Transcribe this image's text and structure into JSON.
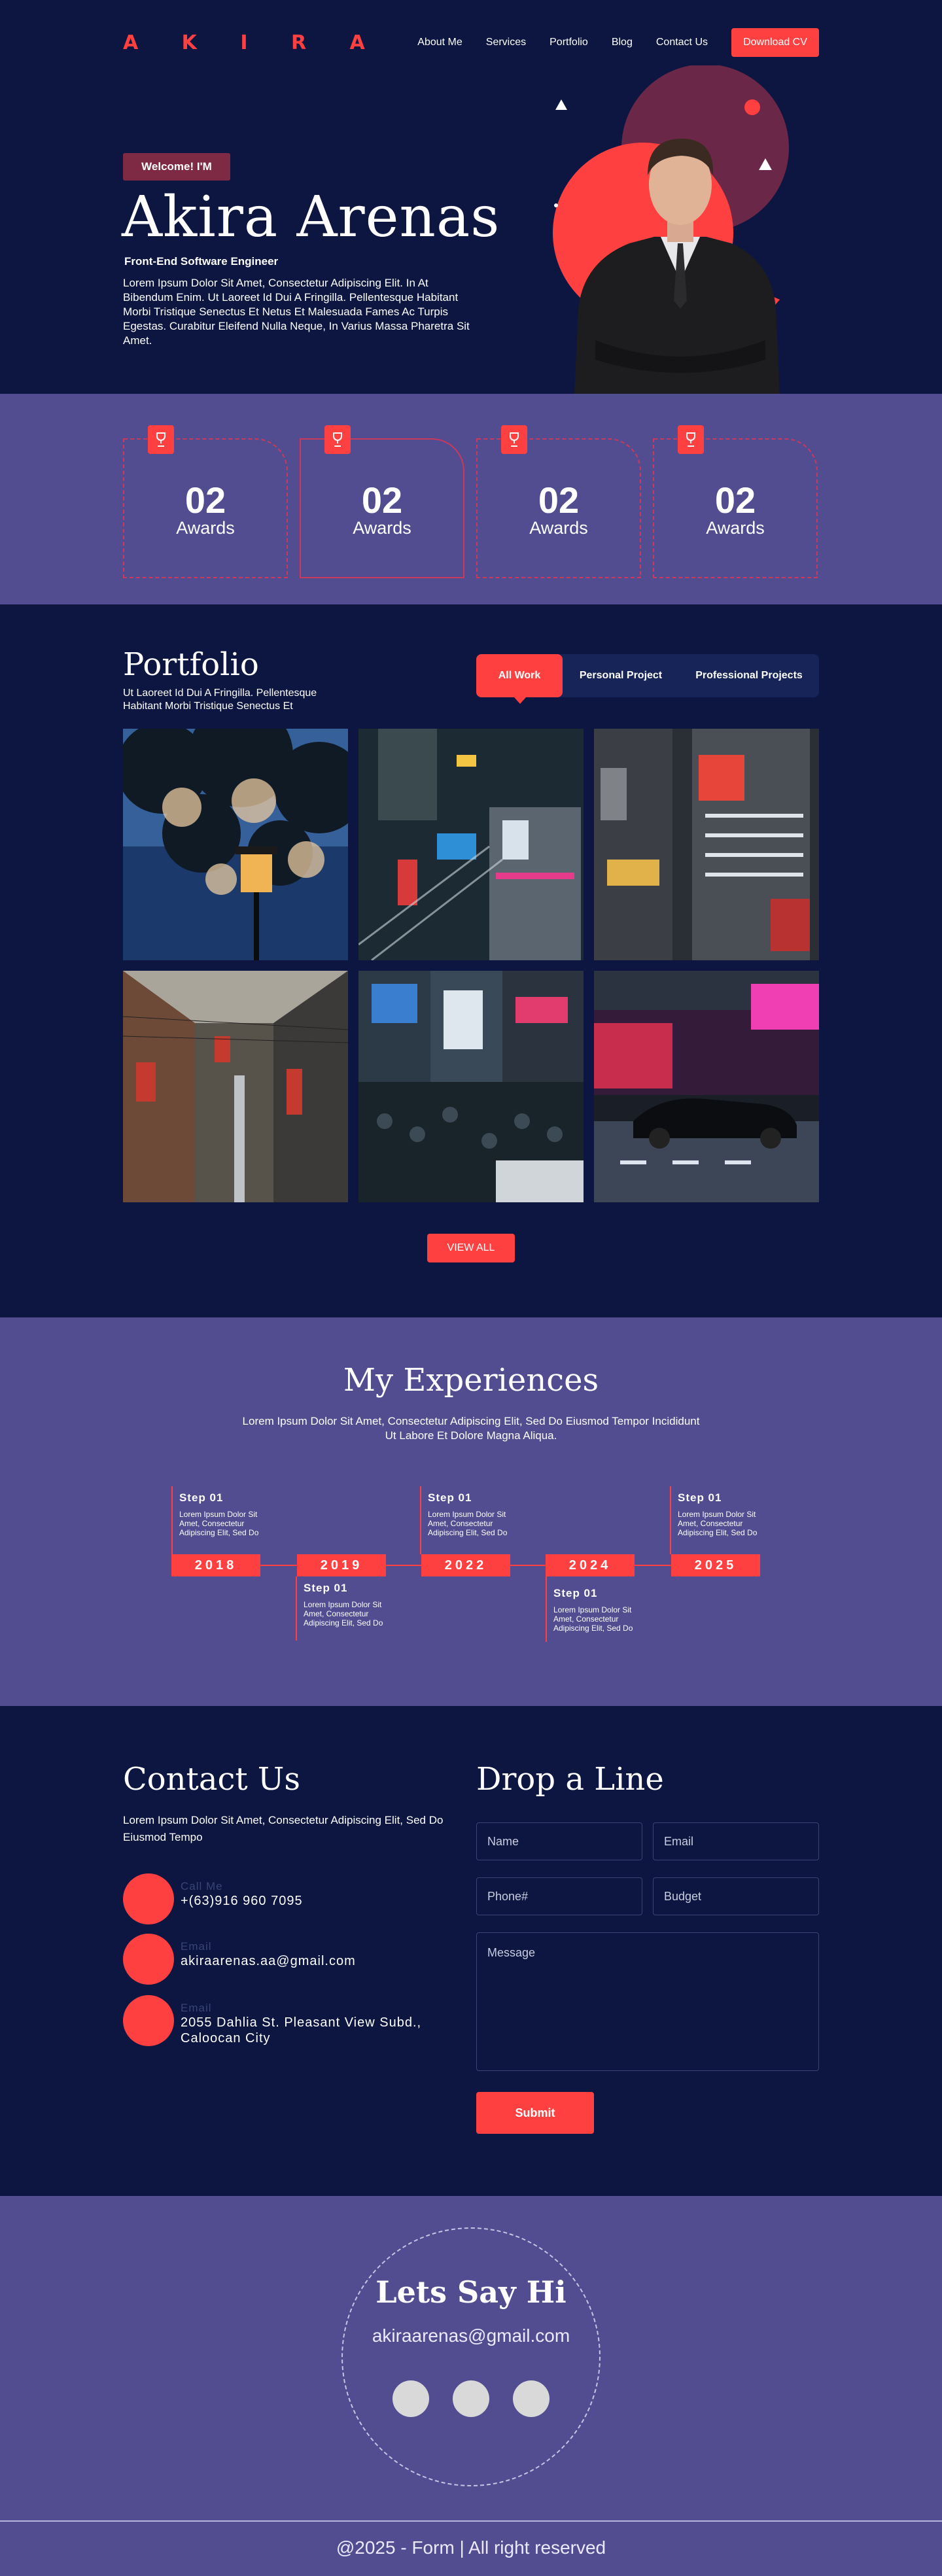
{
  "header": {
    "logo": "A K I R A",
    "nav": [
      "About Me",
      "Services",
      "Portfolio",
      "Blog",
      "Contact Us"
    ],
    "cta": "Download CV"
  },
  "hero": {
    "badge": "Welcome! I'M",
    "name": "Akira Arenas",
    "role": "Front-End Software Engineer",
    "description": "Lorem Ipsum Dolor Sit Amet, Consectetur Adipiscing Elit. In At Bibendum Enim. Ut Laoreet Id Dui A Fringilla. Pellentesque Habitant Morbi Tristique Senectus Et Netus Et Malesuada Fames Ac Turpis Egestas. Curabitur Eleifend Nulla Neque, In Varius Massa Pharetra Sit Amet."
  },
  "awards": [
    {
      "number": "02",
      "label": "Awards"
    },
    {
      "number": "02",
      "label": "Awards"
    },
    {
      "number": "02",
      "label": "Awards"
    },
    {
      "number": "02",
      "label": "Awards"
    }
  ],
  "portfolio": {
    "title": "Portfolio",
    "subtitle": "Ut Laoreet Id Dui A Fringilla. Pellentesque Habitant Morbi Tristique Senectus Et",
    "tabs": [
      "All Work",
      "Personal Project",
      "Professional Projects"
    ],
    "view_all": "VIEW ALL"
  },
  "experience": {
    "title": "My Experiences",
    "subtitle": "Lorem Ipsum Dolor Sit Amet, Consectetur Adipiscing Elit, Sed Do Eiusmod Tempor Incididunt Ut Labore Et Dolore Magna Aliqua.",
    "years": [
      "2018",
      "2019",
      "2022",
      "2024",
      "2025"
    ],
    "steps": [
      {
        "title": "Step 01",
        "desc": "Lorem Ipsum Dolor Sit Amet, Consectetur Adipiscing Elit, Sed Do"
      },
      {
        "title": "Step 01",
        "desc": "Lorem Ipsum Dolor Sit Amet, Consectetur Adipiscing Elit, Sed Do"
      },
      {
        "title": "Step 01",
        "desc": "Lorem Ipsum Dolor Sit Amet, Consectetur Adipiscing Elit, Sed Do"
      },
      {
        "title": "Step 01",
        "desc": "Lorem Ipsum Dolor Sit Amet, Consectetur Adipiscing Elit, Sed Do"
      },
      {
        "title": "Step 01",
        "desc": "Lorem Ipsum Dolor Sit Amet, Consectetur Adipiscing Elit, Sed Do"
      }
    ]
  },
  "contact": {
    "title": "Contact Us",
    "subtitle": "Lorem Ipsum Dolor Sit Amet, Consectetur Adipiscing Elit, Sed Do Eiusmod Tempo",
    "items": [
      {
        "label": "Call Me",
        "value": "+(63)916 960 7095"
      },
      {
        "label": "Email",
        "value": "akiraarenas.aa@gmail.com"
      },
      {
        "label": "Email",
        "value": "2055 Dahlia St. Pleasant View Subd., Caloocan City"
      }
    ]
  },
  "form": {
    "title": "Drop a Line",
    "name_placeholder": "Name",
    "email_placeholder": "Email",
    "phone_placeholder": "Phone#",
    "budget_placeholder": "Budget",
    "message_placeholder": "Message",
    "submit": "Submit"
  },
  "footer": {
    "title": "Lets Say Hi",
    "email": "akiraarenas@gmail.com",
    "copyright": "@2025 - Form | All right reserved"
  },
  "colors": {
    "navy": "#0c1641",
    "purple": "#524c91",
    "accent": "#ff4040",
    "badge": "#7e2a44"
  }
}
